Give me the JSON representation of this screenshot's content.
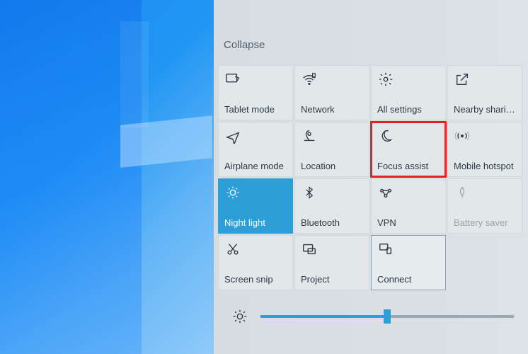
{
  "collapse_label": "Collapse",
  "tiles": [
    {
      "id": "tablet-mode",
      "label": "Tablet mode",
      "icon": "tablet-icon"
    },
    {
      "id": "network",
      "label": "Network",
      "icon": "wifi-icon"
    },
    {
      "id": "all-settings",
      "label": "All settings",
      "icon": "gear-icon"
    },
    {
      "id": "nearby-sharing",
      "label": "Nearby sharing",
      "icon": "share-icon"
    },
    {
      "id": "airplane-mode",
      "label": "Airplane mode",
      "icon": "airplane-icon"
    },
    {
      "id": "location",
      "label": "Location",
      "icon": "location-icon"
    },
    {
      "id": "focus-assist",
      "label": "Focus assist",
      "icon": "moon-icon",
      "highlight": true
    },
    {
      "id": "mobile-hotspot",
      "label": "Mobile hotspot",
      "icon": "hotspot-icon"
    },
    {
      "id": "night-light",
      "label": "Night light",
      "icon": "brightness-icon",
      "active": true
    },
    {
      "id": "bluetooth",
      "label": "Bluetooth",
      "icon": "bluetooth-icon"
    },
    {
      "id": "vpn",
      "label": "VPN",
      "icon": "vpn-icon"
    },
    {
      "id": "battery-saver",
      "label": "Battery saver",
      "icon": "leaf-icon",
      "disabled": true
    },
    {
      "id": "screen-snip",
      "label": "Screen snip",
      "icon": "snip-icon"
    },
    {
      "id": "project",
      "label": "Project",
      "icon": "project-icon"
    },
    {
      "id": "connect",
      "label": "Connect",
      "icon": "connect-icon",
      "outlined": true
    }
  ],
  "brightness": {
    "value": 50,
    "min": 0,
    "max": 100
  },
  "colors": {
    "accent": "#2e9ed6",
    "highlight": "#ee1c25",
    "text": "#2d3a44"
  }
}
